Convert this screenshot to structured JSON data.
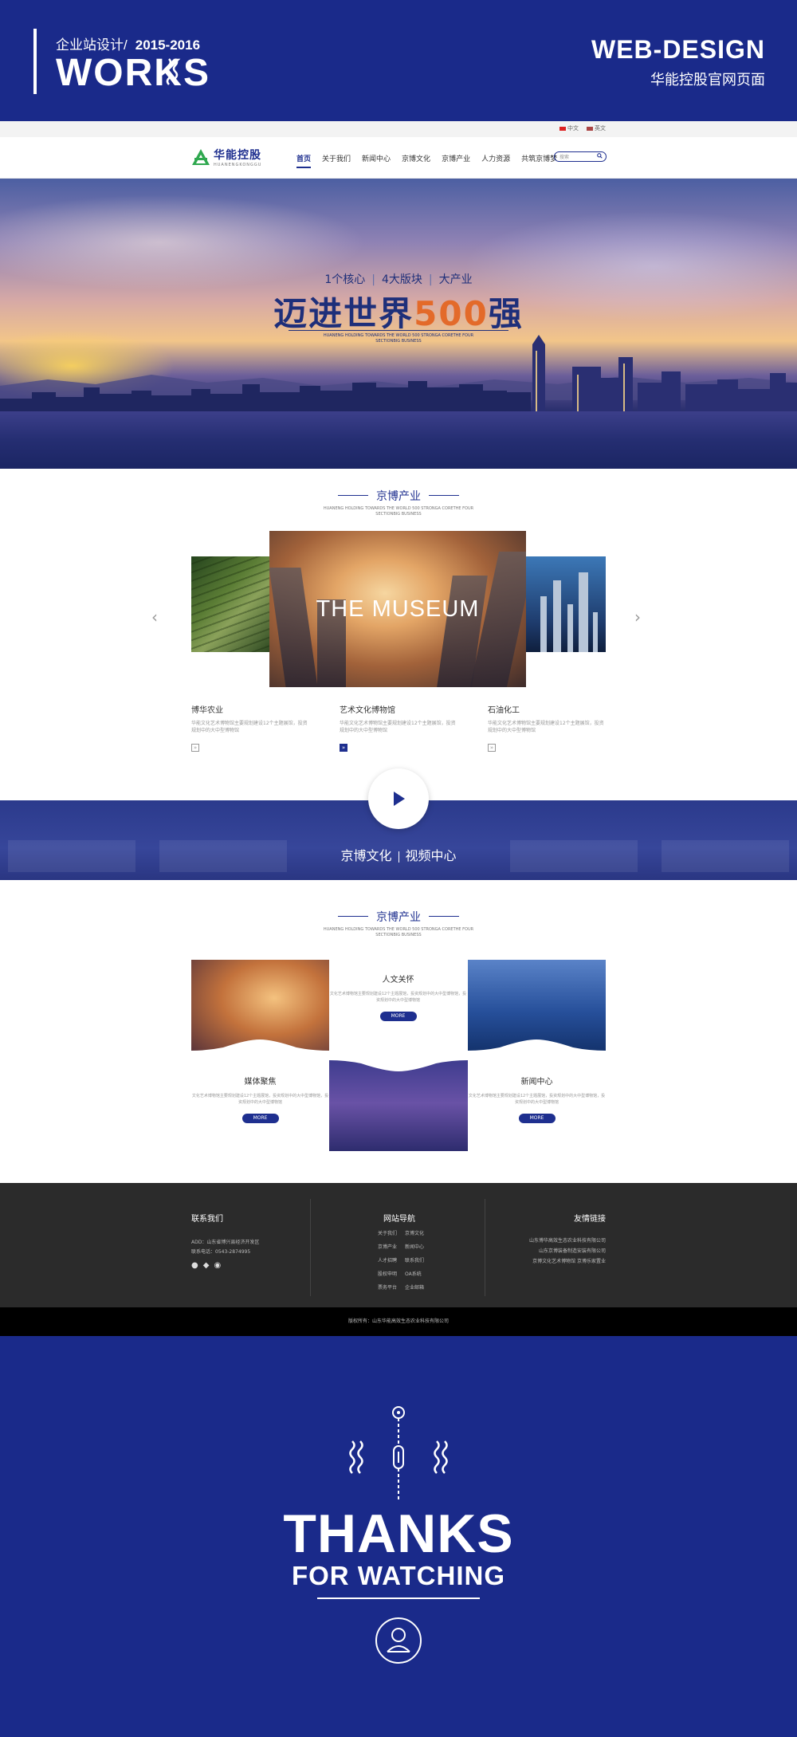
{
  "banner": {
    "subtitle": "企业站设计/",
    "years": "2015-2016",
    "works": "WORKS",
    "web_design": "WEB-DESIGN",
    "project": "华能控股官网页面"
  },
  "site": {
    "langs": [
      "中文",
      "英文"
    ],
    "logo_cn": "华能控股",
    "logo_en": "HUANENGKONGGU",
    "nav": [
      "首页",
      "关于我们",
      "新闻中心",
      "京博文化",
      "京博产业",
      "人力资源",
      "共筑京博梦"
    ],
    "search_placeholder": "搜索",
    "hero": {
      "tags": [
        "1个核心",
        "4大版块",
        "大产业"
      ],
      "headline_pre": "迈进世界",
      "headline_num": "500",
      "headline_post": "强",
      "english": "HUANENG HOLDING TOWARDS THE WORLD 500 STRONGA CORETHE FOUR SECTIONBIG BUSINESS"
    },
    "section1": {
      "title": "京博产业",
      "english": "HUANENG HOLDING TOWARDS THE WORLD 500 STRONGA CORETHE FOUR SECTIONBIG BUSINESS",
      "carousel_label": "THE MUSEUM",
      "cards": [
        {
          "title": "博华农业",
          "desc": "华能文化艺术博物馆主要规划建设12个主题展馆，投资规划中的大中型博物馆",
          "more": "»"
        },
        {
          "title": "艺术文化博物馆",
          "desc": "华能文化艺术博物馆主要规划建设12个主题展馆，投资规划中的大中型博物馆",
          "more": "»"
        },
        {
          "title": "石油化工",
          "desc": "华能文化艺术博物馆主要规划建设12个主题展馆，投资规划中的大中型博物馆",
          "more": "»"
        }
      ]
    },
    "video": {
      "left": "京博文化",
      "right": "视频中心"
    },
    "section2": {
      "title": "京博产业",
      "english": "HUANENG HOLDING TOWARDS THE WORLD 500 STRONGA CORETHE FOUR SECTIONBIG BUSINESS",
      "cells": [
        {
          "title": "人文关怀",
          "desc": "文化艺术博物馆主要规划建设12个主题展馆，投资规划中的大中型博物馆，投资规划中的大中型博物馆",
          "btn": "MORE"
        },
        {
          "title": "媒体聚焦",
          "desc": "文化艺术博物馆主要规划建设12个主题展馆，投资规划中的大中型博物馆，投资规划中的大中型博物馆",
          "btn": "MORE"
        },
        {
          "title": "新闻中心",
          "desc": "文化艺术博物馆主要规划建设12个主题展馆，投资规划中的大中型博物馆，投资规划中的大中型博物馆",
          "btn": "MORE"
        }
      ]
    },
    "footer": {
      "contact_title": "联系我们",
      "address": "ADD：山东省博兴县经济开发区",
      "phone": "联系电话：0543-2874995",
      "nav_title": "网站导航",
      "nav_links": [
        "关于我们",
        "京博文化",
        "京博产业",
        "新闻中心",
        "人才招聘",
        "联系我们",
        "股权申明",
        "OA系统",
        "票务平台",
        "企业邮箱"
      ],
      "friends_title": "友情链接",
      "friends": [
        "山东博华高效生态农业科技有限公司",
        "山东京博装备制造安装有限公司",
        "京博文化艺术博物馆  京博乐家置业"
      ],
      "copyright": "版权所有：山东华能高效生态农业科技有限公司"
    }
  },
  "thanks": {
    "big": "THANKS",
    "small": "FOR WATCHING"
  },
  "colors": {
    "brand": "#1e2f8f",
    "banner_bg": "#1a2a8a",
    "accent": "#e36a2a",
    "footer_bg": "#2b2b2b"
  }
}
